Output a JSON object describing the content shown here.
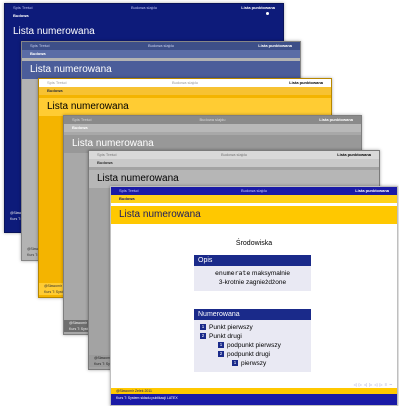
{
  "header": {
    "left": "Spis Treści",
    "middle": "Budowa slajdu",
    "right": "Lista punktowana"
  },
  "subheader": "Budowa",
  "title": "Lista numerowana",
  "footer": {
    "author": "@Sławomir Zelek 2011",
    "course": "Kurs T: System składu publikacji LATEX"
  },
  "front_slide": {
    "section": "Środowiska",
    "opis": {
      "title": "Opis",
      "cmd": "enumerate",
      "line1_rest": " maksymalnie",
      "line2": "3-krotnie zagnieżdżone"
    },
    "numerowana": {
      "title": "Numerowana",
      "items": [
        {
          "num": "1",
          "label": "Punkt pierwszy"
        },
        {
          "num": "2",
          "label": "Punkt drugi"
        }
      ],
      "subitems": [
        {
          "num": "1",
          "label": "podpunkt pierwszy"
        },
        {
          "num": "2",
          "label": "podpunkt drugi"
        }
      ],
      "subsubitems": [
        {
          "num": "1",
          "label": "pierwszy"
        }
      ]
    },
    "nav_glyphs": "◁ ▷ ◁ ▷ ◁ ▷ ≡ ∽"
  },
  "colors": {
    "front_header": "#1a1aa6",
    "front_title_bar": "#ffc800",
    "block_title": "#1a2a8a",
    "block_body": "#e9e9f3"
  }
}
